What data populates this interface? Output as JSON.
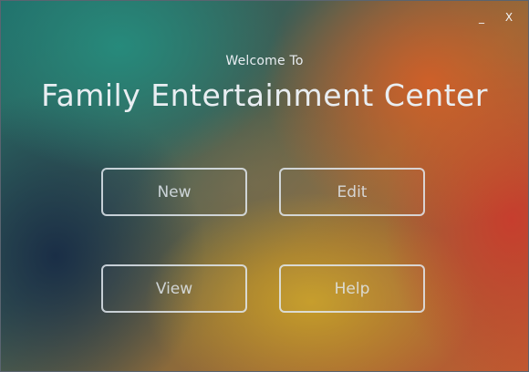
{
  "window_controls": {
    "minimize_label": "_",
    "close_label": "X"
  },
  "welcome_text": "Welcome To",
  "app_title": "Family Entertainment Center",
  "buttons": {
    "new_label": "New",
    "edit_label": "Edit",
    "view_label": "View",
    "help_label": "Help"
  },
  "colors": {
    "text": "#e9eef2",
    "button_border": "#e1e8ee",
    "bg_teal": "#268c7d",
    "bg_orange": "#d25f28",
    "bg_red": "#c83c2d",
    "bg_yellow": "#c8a028",
    "bg_navy": "#192d46"
  }
}
